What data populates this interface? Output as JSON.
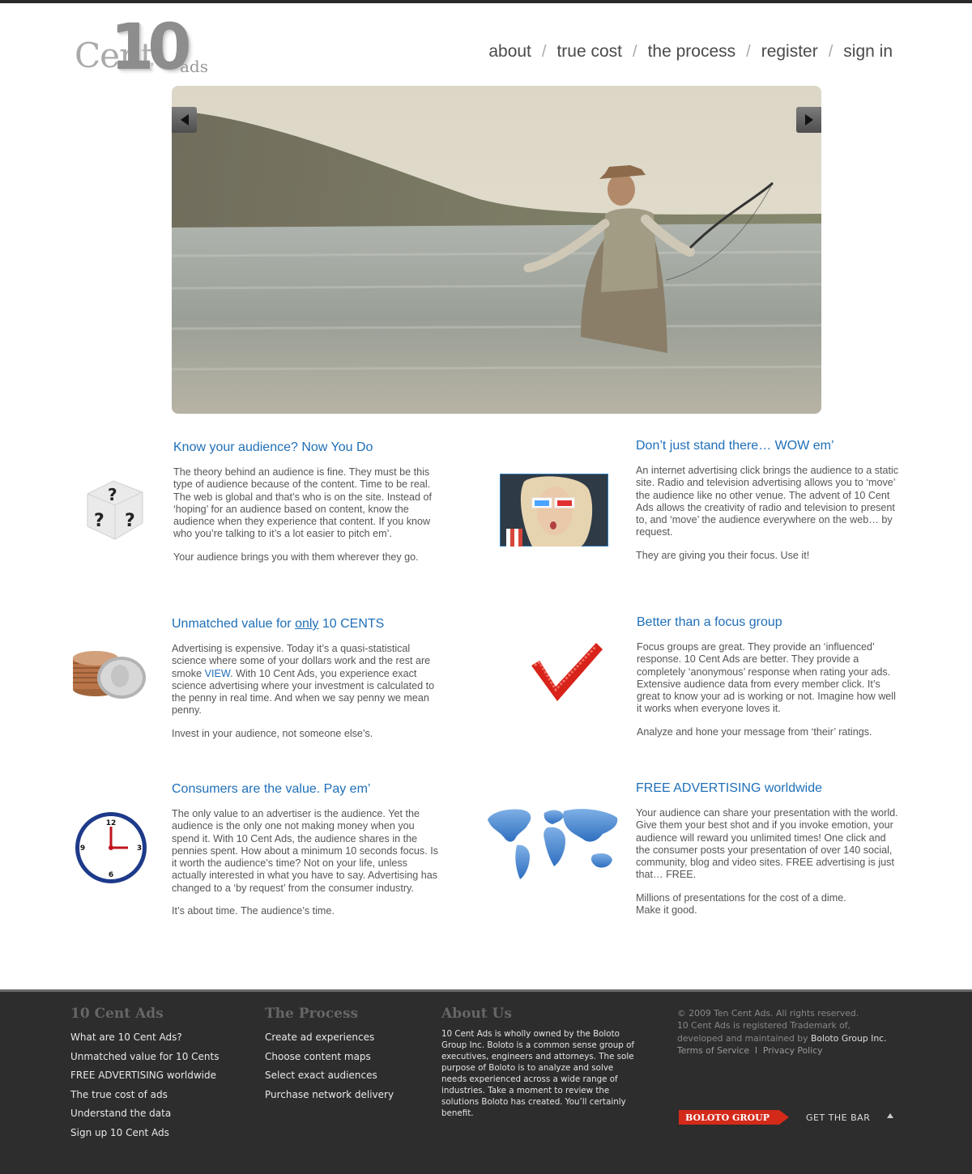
{
  "logo": {
    "cent": "Cent",
    "ten": "10",
    "ads": "ads"
  },
  "nav": {
    "items": [
      "about",
      "true cost",
      "the process",
      "register",
      "sign in"
    ],
    "separator": "/"
  },
  "hero": {
    "prev_icon": "triangle-left-icon",
    "next_icon": "triangle-right-icon"
  },
  "features": {
    "audience": {
      "title": "Know your audience?  Now You Do",
      "p1": "The theory behind an audience is fine. They must be this type of audience because of the content. Time to be real. The web is global and that’s who is on the site. Instead of ‘hoping’ for an audience based on content, know the audience when they experience that content. If you know who you’re talking to it’s a lot easier to pitch em’.",
      "p2": "Your audience brings you with them wherever they go.",
      "icon": "question-dice-icon"
    },
    "wow": {
      "title": "Don’t just stand there… WOW em’",
      "p1": "An internet advertising click brings the audience to a static site. Radio and television advertising allows you to ‘move’ the audience like no other venue. The advent of 10 Cent Ads allows the creativity of radio and television to present to, and ‘move’ the audience everywhere on the web… by request.",
      "p2": "They are giving you their focus. Use it!",
      "icon": "3d-glasses-woman-photo"
    },
    "value": {
      "title_pre": "Unmatched value for ",
      "title_only": "only",
      "title_post": " 10 CENTS",
      "p1_pre": "Advertising is expensive. Today it’s a quasi-statistical science where some of your dollars work and the rest are smoke ",
      "p1_link": "VIEW",
      "p1_post": ". With 10 Cent Ads, you experience exact science advertising where your investment is calculated to the penny in real time. And when we say penny we mean penny.",
      "p2": "Invest in your audience, not someone else’s.",
      "icon": "coin-stack-icon"
    },
    "focus": {
      "title": "Better than a focus group",
      "p1": "Focus groups are great. They provide an ‘influenced’ response. 10 Cent Ads are better. They provide a completely ‘anonymous’ response when rating your ads. Extensive audience data from every member click. It’s great to know your ad is working or not. Imagine how well it works when everyone loves it.",
      "p2": "Analyze and hone your message from ‘their’ ratings.",
      "icon": "red-checkmark-icon"
    },
    "consumers": {
      "title": "Consumers are the value.  Pay em’",
      "p1": "The only value to an advertiser is the audience. Yet the audience is the only one not making money when you spend it. With 10 Cent Ads, the audience shares in the pennies spent. How about a minimum 10 seconds focus. Is it worth the audience’s time? Not on your life, unless actually interested in what you have to say. Advertising has changed to a ‘by request’ from the consumer industry.",
      "p2": "It’s about time. The audience’s time.",
      "icon": "clock-icon",
      "clock_numbers": [
        "12",
        "3",
        "6",
        "9"
      ]
    },
    "free": {
      "title": "FREE ADVERTISING worldwide",
      "p1": "Your audience can share your presentation with the world. Give them your best shot and if you invoke emotion, your audience will reward you unlimited times! One click and the consumer posts your presentation of over 140 social, community, blog and video sites. FREE advertising is just that… FREE.",
      "p2a": "Millions of presentations for the cost of a dime.",
      "p2b": "Make it good.",
      "icon": "world-map-icon"
    }
  },
  "footer": {
    "col1": {
      "title": "10 Cent Ads",
      "items": [
        "What are 10 Cent Ads?",
        "Unmatched value for 10 Cents",
        "FREE ADVERTISING worldwide",
        "The true cost of ads",
        "Understand the data",
        "Sign up 10 Cent Ads"
      ]
    },
    "col2": {
      "title": "The Process",
      "items": [
        "Create ad experiences",
        "Choose content maps",
        "Select exact audiences",
        "Purchase network delivery"
      ]
    },
    "col3": {
      "title": "About Us",
      "text": "10 Cent Ads is wholly owned by the Boloto Group Inc.  Boloto is a common sense group of executives, engineers and attorneys. The sole purpose of Boloto is to analyze and solve needs experienced across a wide range of industries. Take a moment to review the solutions Boloto has created. You’ll certainly benefit."
    },
    "legal": {
      "copyright": "© 2009 Ten Cent Ads. All rights reserved.",
      "line2": "10 Cent Ads is registered Trademark of,",
      "line3_pre": "developed and maintained by ",
      "line3_company": "Boloto Group Inc.",
      "terms": "Terms of Service",
      "divider": "I",
      "privacy": "Privacy Policy"
    },
    "boloto_badge": "BOLOTO GROUP",
    "get_the_bar": "GET THE BAR",
    "up_icon": "caret-up-icon"
  },
  "colors": {
    "accent_blue": "#1f6fb8",
    "footer_bg": "#2d2d2d",
    "badge_red": "#d42a1a"
  }
}
